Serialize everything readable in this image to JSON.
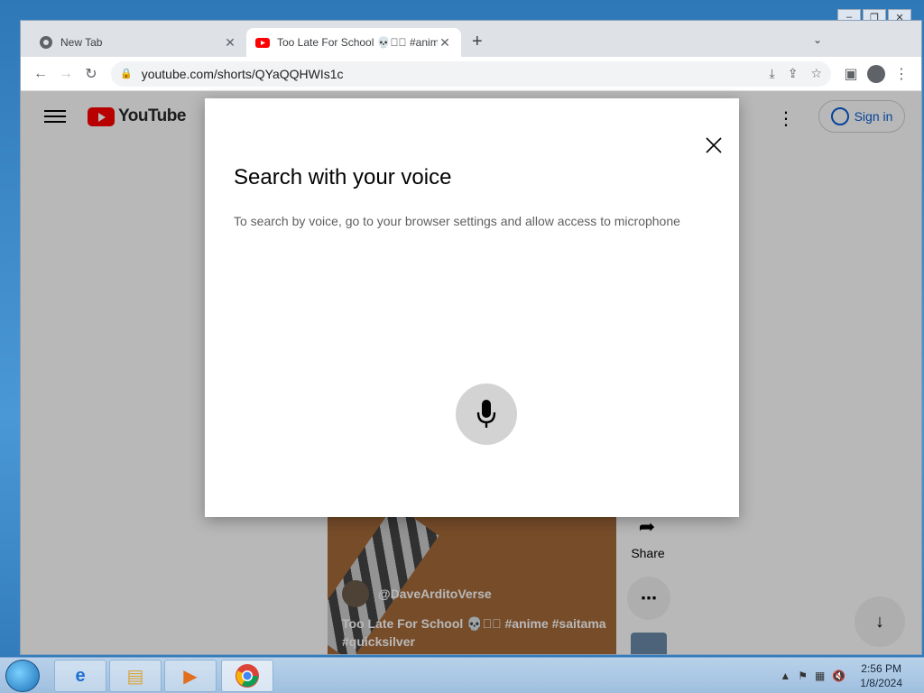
{
  "browser": {
    "tabs": [
      {
        "title": "New Tab",
        "active": false
      },
      {
        "title": "Too Late For School 💀⃞⃗ #anim",
        "active": true
      }
    ],
    "new_tab_label": "+",
    "url": "youtube.com/shorts/QYaQQHWIs1c"
  },
  "youtube": {
    "logo_text": "YouTube",
    "sign_in_label": "Sign in",
    "video": {
      "channel": "@DaveArditoVerse",
      "title": "Too Late For School 💀⃞⃗ #anime #saitama #quicksilver"
    },
    "share_label": "Share"
  },
  "dialog": {
    "title": "Search with your voice",
    "message": "To search by voice, go to your browser settings and allow access to microphone"
  },
  "taskbar": {
    "time": "2:56 PM",
    "date": "1/8/2024"
  },
  "colors": {
    "youtube_red": "#ff0000",
    "link_blue": "#065fd4"
  }
}
